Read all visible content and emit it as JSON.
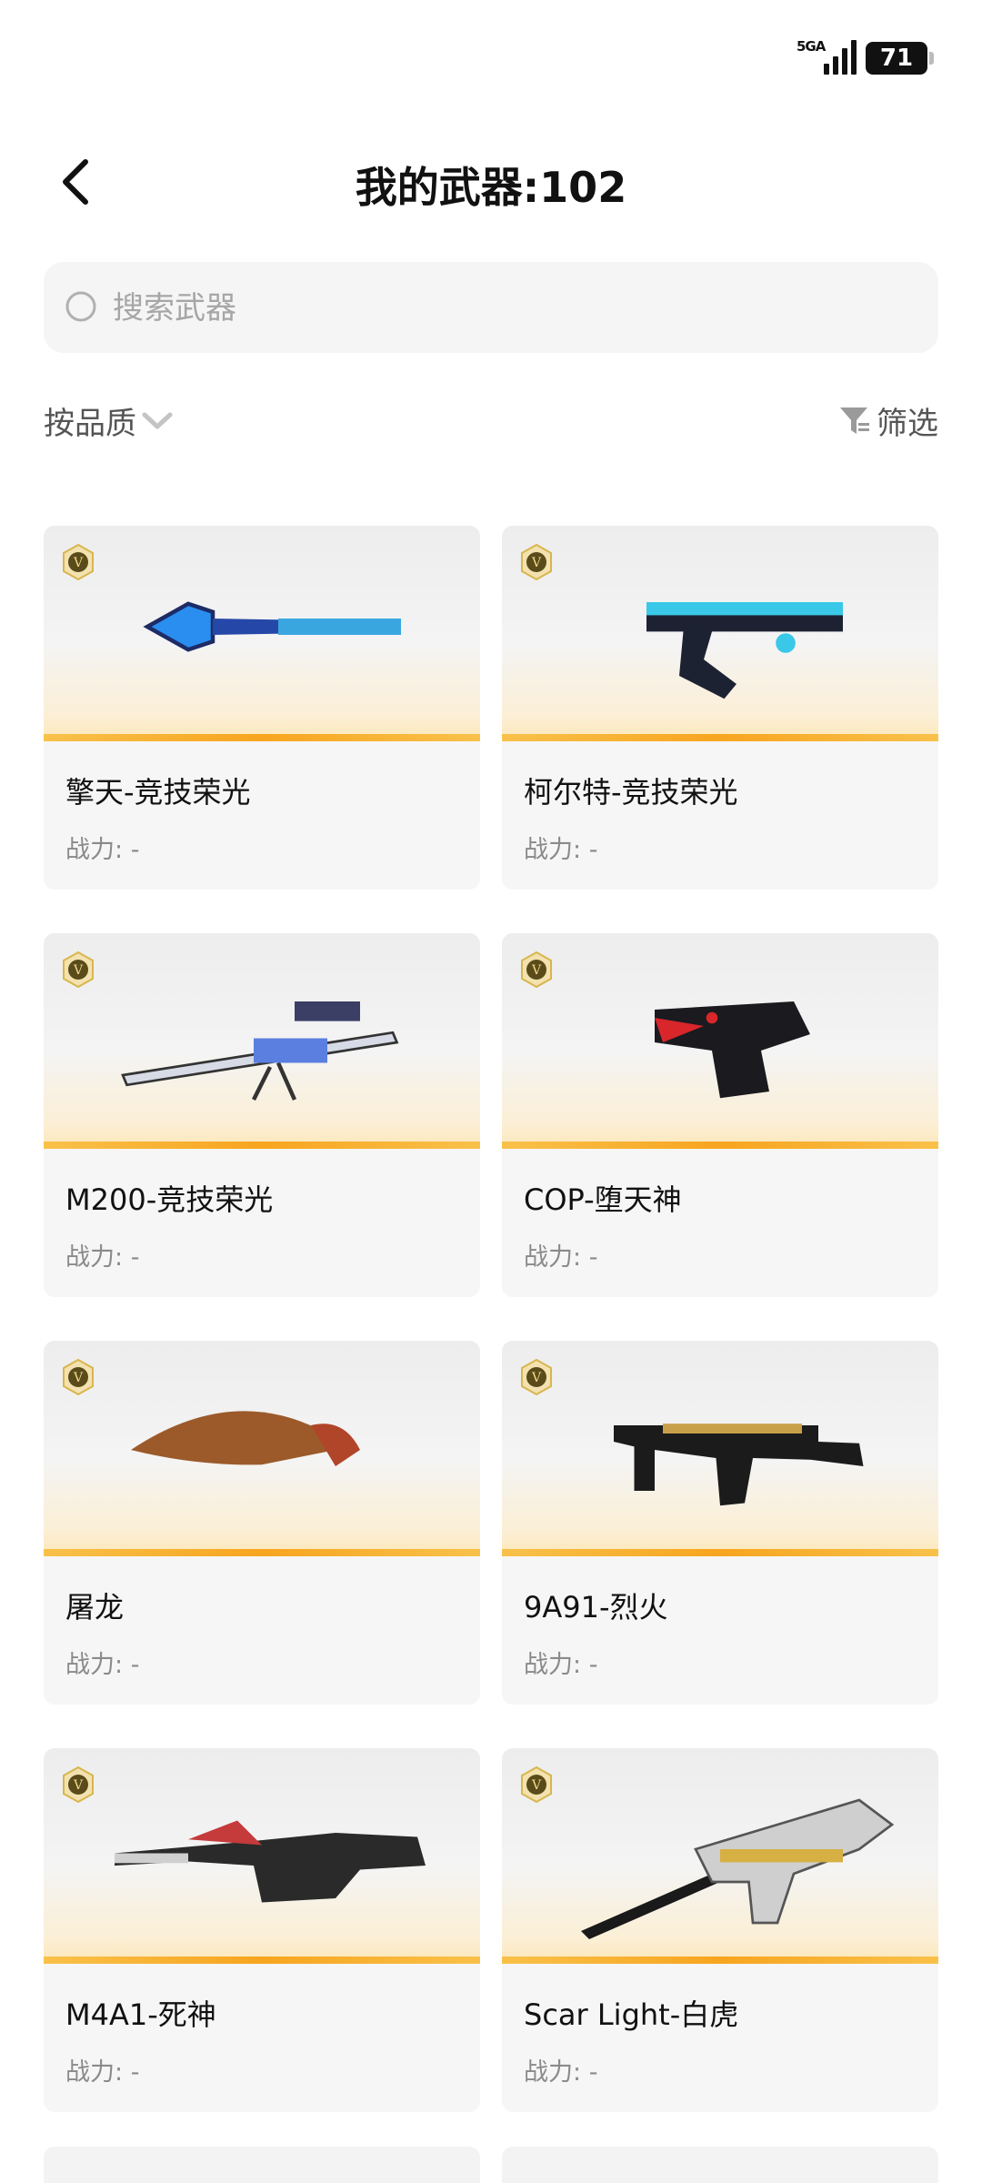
{
  "status_bar": {
    "network": "5GA",
    "battery": "71"
  },
  "header": {
    "title": "我的武器:102"
  },
  "search": {
    "placeholder": "搜索武器"
  },
  "controls": {
    "sort_label": "按品质",
    "filter_label": "筛选"
  },
  "power_label": "战力:",
  "weapons": [
    {
      "name": "擎天-竞技荣光",
      "power": "-",
      "kind": "hammer",
      "accent": "#2a8ef0"
    },
    {
      "name": "柯尔特-竞技荣光",
      "power": "-",
      "kind": "pistol",
      "accent": "#39c8e8"
    },
    {
      "name": "M200-竞技荣光",
      "power": "-",
      "kind": "sniper",
      "accent": "#5a7fe0"
    },
    {
      "name": "COP-堕天神",
      "power": "-",
      "kind": "cop",
      "accent": "#d8262a"
    },
    {
      "name": "屠龙",
      "power": "-",
      "kind": "knife",
      "accent": "#b0452a"
    },
    {
      "name": "9A91-烈火",
      "power": "-",
      "kind": "smg",
      "accent": "#c9a04a"
    },
    {
      "name": "M4A1-死神",
      "power": "-",
      "kind": "rifle",
      "accent": "#c53a3a"
    },
    {
      "name": "Scar Light-白虎",
      "power": "-",
      "kind": "scar",
      "accent": "#d6b043"
    }
  ]
}
